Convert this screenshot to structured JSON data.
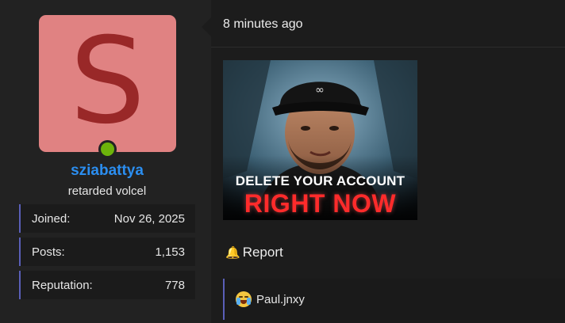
{
  "user": {
    "avatar_letter": "S",
    "avatar_bg": "#e08282",
    "avatar_fg": "#992828",
    "online_color": "#6db30b",
    "username": "sziabattya",
    "username_color": "#2b8ef0",
    "title": "retarded volcel",
    "stats": [
      {
        "label": "Joined:",
        "value": "Nov 26, 2025"
      },
      {
        "label": "Posts:",
        "value": "1,153"
      },
      {
        "label": "Reputation:",
        "value": "778"
      }
    ]
  },
  "post": {
    "timestamp": "8 minutes ago",
    "image": {
      "line1": "DELETE YOUR ACCOUNT",
      "line2": "RIGHT NOW"
    },
    "report_icon": "bell-icon",
    "report_label": "Report",
    "reaction": {
      "icon": "crying-laughing-emoji-icon",
      "user": "Paul.jnxy"
    }
  }
}
